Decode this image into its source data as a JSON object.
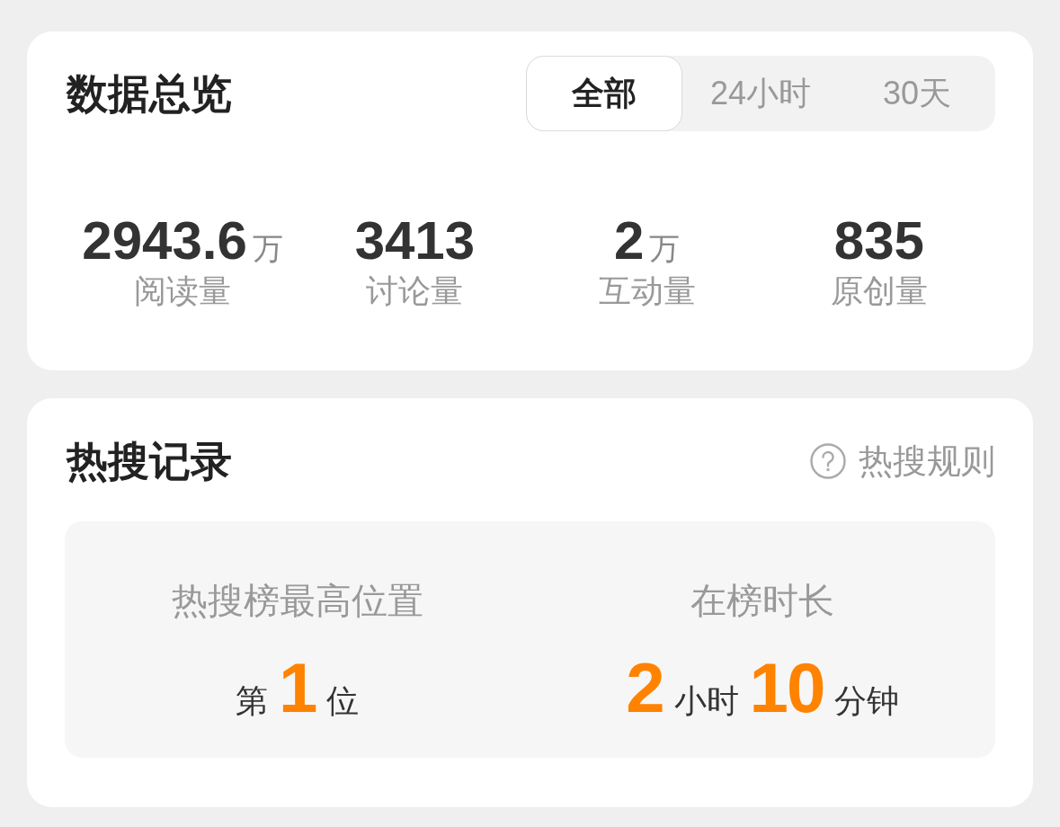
{
  "overview": {
    "title": "数据总览",
    "tabs": [
      {
        "label": "全部",
        "selected": true
      },
      {
        "label": "24小时",
        "selected": false
      },
      {
        "label": "30天",
        "selected": false
      }
    ],
    "stats": [
      {
        "value": "2943.6",
        "unit": "万",
        "label": "阅读量"
      },
      {
        "value": "3413",
        "label": "讨论量"
      },
      {
        "value": "2",
        "unit": "万",
        "label": "互动量"
      },
      {
        "value": "835",
        "label": "原创量"
      }
    ]
  },
  "hot_search": {
    "title": "热搜记录",
    "rules_link": "热搜规则",
    "items": [
      {
        "label": "热搜榜最高位置",
        "parts": [
          {
            "kind": "text",
            "text": "第"
          },
          {
            "kind": "number",
            "text": "1"
          },
          {
            "kind": "text",
            "text": "位"
          }
        ]
      },
      {
        "label": "在榜时长",
        "parts": [
          {
            "kind": "number",
            "text": "2"
          },
          {
            "kind": "text",
            "text": "小时"
          },
          {
            "kind": "number",
            "text": "10"
          },
          {
            "kind": "text",
            "text": "分钟"
          }
        ]
      }
    ]
  }
}
